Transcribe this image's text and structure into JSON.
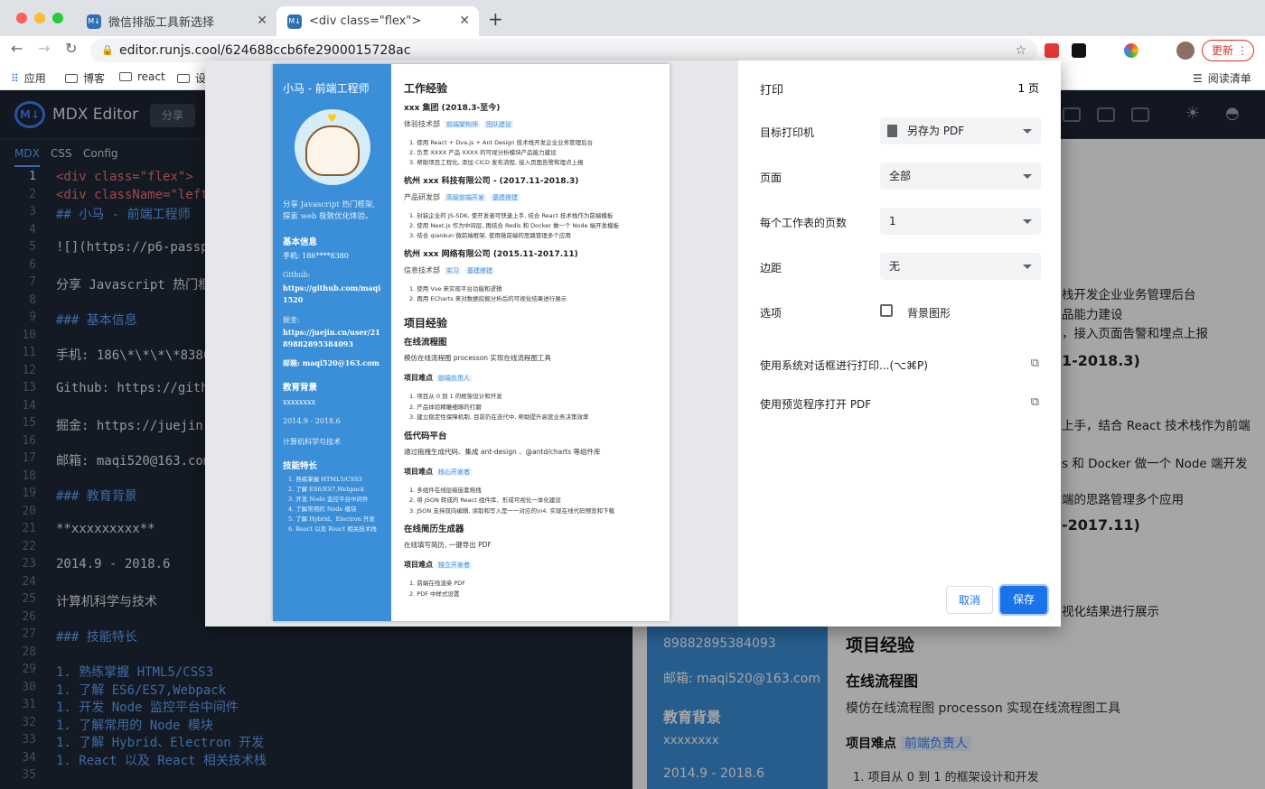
{
  "browser": {
    "tabs": [
      {
        "title": "微信排版工具新选择"
      },
      {
        "title": "<div class=\"flex\">"
      }
    ],
    "url": "editor.runjs.cool/624688ccb6fe2900015728ac",
    "update_label": "更新",
    "bookmarks": [
      "应用",
      "博客",
      "react",
      "设"
    ],
    "reading_list": "阅读清单"
  },
  "app": {
    "brand": "MDX Editor",
    "share": "分享",
    "editor_tabs": [
      "MDX",
      "CSS",
      "Config"
    ],
    "lines": [
      "<div class=\"flex\">",
      "<div className=\"left\"",
      "## 小马 - 前端工程师",
      "",
      "![](https://p6-passpo",
      "",
      "分享 Javascript 热门框架",
      "",
      "### 基本信息",
      "",
      "手机: 186\\*\\*\\*\\*8380",
      "",
      "Github: https://githul",
      "",
      "掘金: https://juejin.c",
      "",
      "邮箱: maqi520@163.com",
      "",
      "### 教育背景",
      "",
      "**xxxxxxxxx**",
      "",
      "2014.9 - 2018.6",
      "",
      "计算机科学与技术",
      "",
      "### 技能特长",
      "",
      "1. 熟练掌握 HTML5/CSS3",
      "1. 了解 ES6/ES7,Webpack",
      "1. 开发 Node 监控平台中间件",
      "1. 了解常用的 Node 模块",
      "1. 了解 Hybrid、Electron 开发",
      "1. React 以及 React 相关技术栈",
      ""
    ],
    "preview_right": [
      "栈开发企业业务管理后台",
      "品能力建设",
      "，接入页面告警和埋点上报",
      "1-2018.3)",
      "上手，结合 React 技术栈作为前端",
      "s 和 Docker 做一个 Node 端开发",
      "端的思路管理多个应用",
      "-2017.11)",
      "视化结果进行展示"
    ],
    "preview_bottom": {
      "juejin_tail": "89882895384093",
      "email": "邮箱: maqi520@163.com",
      "edu": "教育背景",
      "school": "xxxxxxxx",
      "years": "2014.9 - 2018.6",
      "proj": "项目经验",
      "flow": "在线流程图",
      "flow_desc": "模仿在线流程图 processon 实现在线流程图工具",
      "diff": "项目难点",
      "diff_tag": "前端负责人",
      "item": "1. 项目从 0 到 1 的框架设计和开发"
    }
  },
  "print": {
    "title": "打印",
    "pages": "1 页",
    "rows": [
      {
        "label": "目标打印机",
        "value": "另存为 PDF"
      },
      {
        "label": "页面",
        "value": "全部"
      },
      {
        "label": "每个工作表的页数",
        "value": "1"
      },
      {
        "label": "边距",
        "value": "无"
      }
    ],
    "options_label": "选项",
    "bg_label": "背景图形",
    "system_dialog": "使用系统对话框进行打印...(⌥⌘P)",
    "open_preview": "使用预览程序打开 PDF",
    "cancel": "取消",
    "save": "保存"
  },
  "resume": {
    "name": "小马 - 前端工程师",
    "intro": "分享 Javascript 热门框架, 探索 web 极致优化体验。",
    "basic": "基本信息",
    "phone": "手机: 186****8380",
    "github_label": "Github:",
    "github": "https://github.com/maqi1520",
    "juejin_label": "掘金:",
    "juejin": "https://juejin.cn/user/2189882895384093",
    "email": "邮箱: maqi520@163.com",
    "edu": "教育背景",
    "school": "xxxxxxxx",
    "years": "2014.9 - 2018.6",
    "major": "计算机科学与技术",
    "skills_title": "技能特长",
    "skills": [
      "1. 熟练掌握 HTML5/CSS3",
      "2. 了解 ES6/ES7,Webpack",
      "3. 开发 Node 监控平台中间件",
      "4. 了解常用的 Node 模块",
      "5. 了解 Hybrid、Electron 开发",
      "6. React 以及 React 相关技术栈"
    ],
    "work_title": "工作经验",
    "jobs": [
      {
        "company": "xxx 集团 (2018.3-至今)",
        "dept": "体验技术部",
        "tags": [
          "前端架构师",
          "团队建设"
        ],
        "items": [
          "1. 使用 React + Dva.js + Ant Design 技术栈开发企业业务管理后台",
          "2. 负责 XXXX 产品 XXXX 的可视分析模块产品能力建设",
          "3. 帮助项目工程化, 添加 CICD 发布流程, 接入页面告警和埋点上报"
        ]
      },
      {
        "company": "杭州 xxx 科技有限公司 - (2017.11-2018.3)",
        "dept": "产品研发部",
        "tags": [
          "高级前端开发",
          "基建搭建"
        ],
        "items": [
          "1. 封装企业的 JS-SDK, 使开发者可快速上手, 结合 React 技术栈作为前端模板",
          "2. 使用 Next.js 作为中间层, 再结合 Redis 和 Docker 做一个 Node 端开发模板",
          "3. 结合 qiankun 微前端框架, 使用微前端的思路管理多个应用"
        ]
      },
      {
        "company": "杭州 xxx 网络有限公司 (2015.11-2017.11)",
        "dept": "信息技术部",
        "tags": [
          "实习",
          "基建搭建"
        ],
        "items": [
          "1. 使用 Vue 来实现平台功能和逻辑",
          "2. 再用 ECharts 来对数据挖掘分析后的可视化结果进行展示"
        ]
      }
    ],
    "proj_title": "项目经验",
    "projects": [
      {
        "name": "在线流程图",
        "desc": "模仿在线流程图 processon 实现在线流程图工具",
        "tag": "前端负责人",
        "items": [
          "1. 项目从 0 到 1 的框架设计和开发",
          "2. 产品体验精雕细琢的打磨",
          "3. 建立稳定性保障机制, 目前仍在迭代中, 帮助提升高营业务决策效率"
        ]
      },
      {
        "name": "低代码平台",
        "desc": "通过拖拽生成代码、集成 ant-design 、@antd/charts 等组件库",
        "tag": "核心开发者",
        "items": [
          "1. 多组件在线层级嵌套拖拽",
          "2. 将 JSON 转成的 React 组件库、形成可视化一体化建设",
          "3. JSON 支持双向编辑, 读取和写入是一一对应的\\n4. 实现在线代码预览和下载"
        ]
      },
      {
        "name": "在线简历生成器",
        "desc": "在线填写简历, 一键导出 PDF",
        "tag": "独立开发者",
        "items": [
          "1. 前端在线渲染 PDF",
          "2. PDF 中样式设置"
        ]
      }
    ],
    "diff_label": "项目难点"
  }
}
